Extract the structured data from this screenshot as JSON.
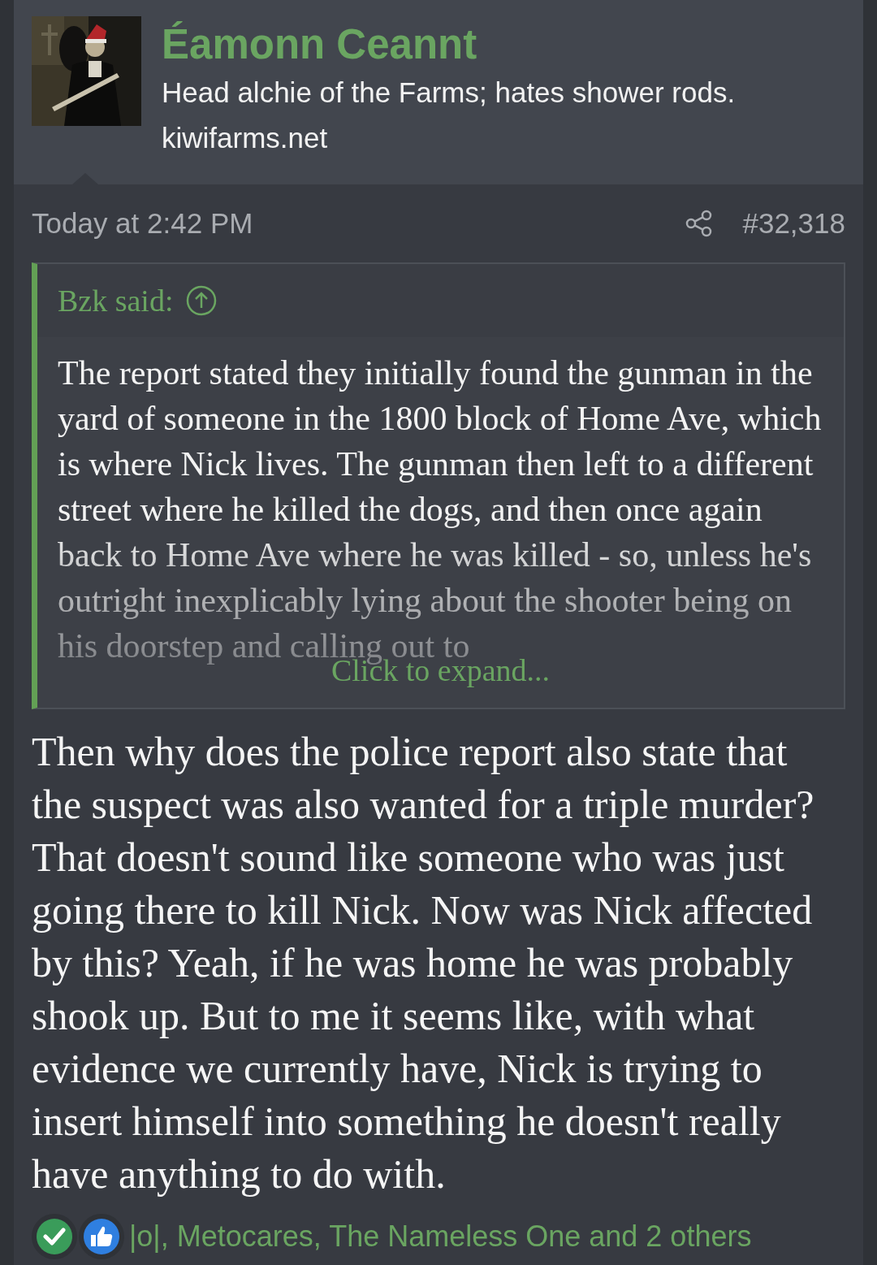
{
  "author": {
    "name": "Éamonn Ceannt",
    "title": "Head alchie of the Farms; hates shower rods.",
    "site": "kiwifarms.net"
  },
  "post": {
    "time": "Today at 2:42 PM",
    "number": "#32,318"
  },
  "quote": {
    "attribution": "Bzk said:",
    "text": "The report stated they initially found the gunman in the yard of someone in the 1800 block of Home Ave, which is where Nick lives. The gunman then left to a different street where he killed the dogs, and then once again back to Home Ave where he was killed - so, unless he's outright inexplicably lying about the shooter being on his doorstep and calling out to",
    "expand": "Click to expand..."
  },
  "body": "Then why does the police report also state that the suspect was also wanted for a triple murder? That doesn't sound like someone who was just going there to kill Nick. Now was Nick affected by this? Yeah, if he was home he was probably shook up. But to me it seems like, with what evidence we currently have, Nick is trying to insert himself into something he doesn't really have anything to do with.",
  "reactions": {
    "icons": [
      {
        "kind": "check"
      },
      {
        "kind": "like"
      }
    ],
    "text": "|o|, Metocares, The Nameless One and 2 others"
  }
}
